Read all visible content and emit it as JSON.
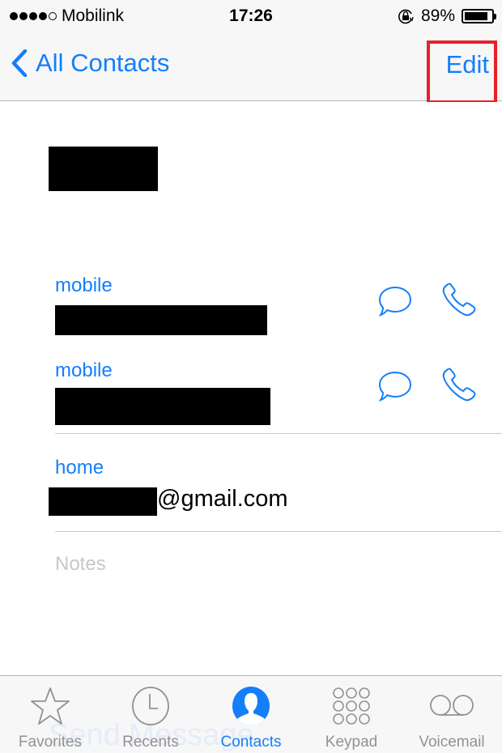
{
  "status_bar": {
    "signal_bars_filled": 4,
    "signal_bars_total": 5,
    "carrier": "Mobilink",
    "time": "17:26",
    "orientation_lock_icon": "rotation-lock-icon",
    "battery_percent_text": "89%",
    "battery_level": 0.89
  },
  "nav": {
    "back_label": "All Contacts",
    "edit_label": "Edit",
    "highlight_color": "#e8202a"
  },
  "contact": {
    "name": "[redacted]",
    "phones": [
      {
        "label": "mobile",
        "number": "[redacted]",
        "actions": [
          "message-icon",
          "phone-icon"
        ]
      },
      {
        "label": "mobile",
        "number": "[redacted]",
        "actions": [
          "message-icon",
          "phone-icon"
        ]
      }
    ],
    "email": {
      "label": "home",
      "user": "[redacted]",
      "domain": "@gmail.com"
    },
    "notes_placeholder": "Notes"
  },
  "tabbar": {
    "ghost_text": "Send Message",
    "tabs": [
      {
        "label": "Favorites",
        "icon": "star-icon",
        "active": false
      },
      {
        "label": "Recents",
        "icon": "clock-icon",
        "active": false
      },
      {
        "label": "Contacts",
        "icon": "contacts-icon",
        "active": true
      },
      {
        "label": "Keypad",
        "icon": "keypad-icon",
        "active": false
      },
      {
        "label": "Voicemail",
        "icon": "voicemail-icon",
        "active": false
      }
    ]
  },
  "colors": {
    "accent": "#157efb",
    "inactive": "#929292",
    "placeholder": "#c7c7cd",
    "bar_background": "#f7f7f7"
  }
}
